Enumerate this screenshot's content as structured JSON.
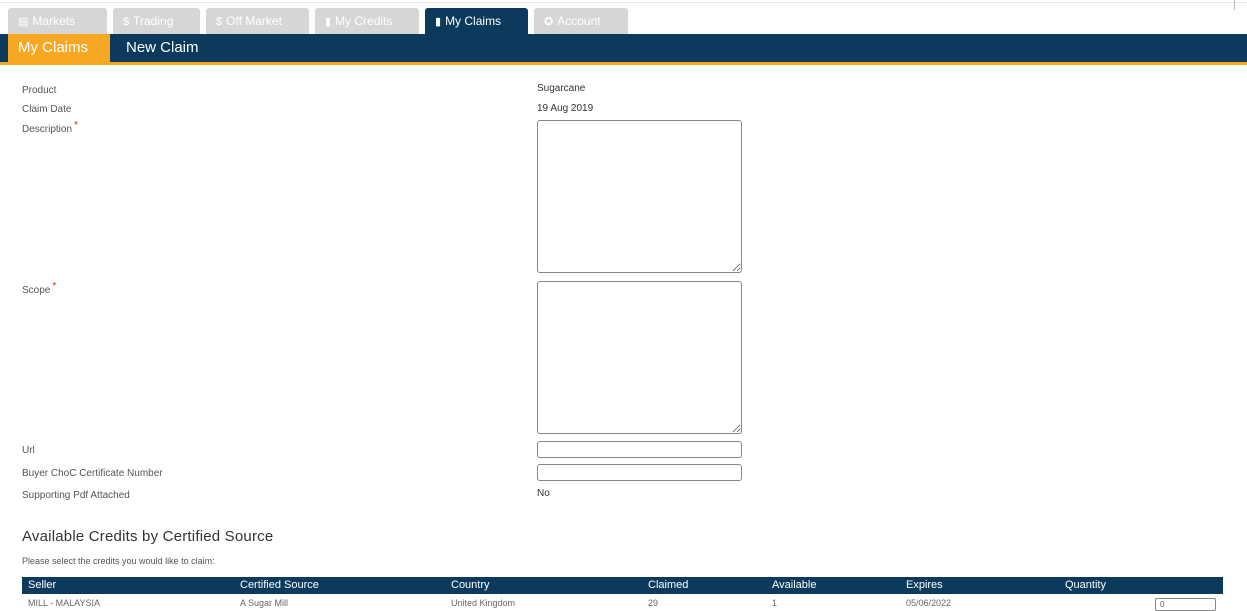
{
  "tabs": [
    {
      "icon": "list-icon",
      "glyph": "▤",
      "label": "Markets"
    },
    {
      "icon": "dollar-icon",
      "glyph": "$",
      "label": "Trading"
    },
    {
      "icon": "dollar-icon",
      "glyph": "$",
      "label": "Off Market"
    },
    {
      "icon": "document-icon",
      "glyph": "▮",
      "label": "My Credits"
    },
    {
      "icon": "document-icon",
      "glyph": "▮",
      "label": "My Claims"
    },
    {
      "icon": "gear-icon",
      "glyph": "✪",
      "label": "Account"
    }
  ],
  "active_tab": "My Claims",
  "subnav": {
    "active": "My Claims",
    "item": "New Claim"
  },
  "form": {
    "product_label": "Product",
    "product_value": "Sugarcane",
    "claim_date_label": "Claim Date",
    "claim_date_value": "19 Aug 2019",
    "description_label": "Description",
    "scope_label": "Scope",
    "required_mark": "*",
    "url_label": "Url",
    "choc_label": "Buyer ChoC Certificate Number",
    "pdf_label": "Supporting Pdf Attached",
    "pdf_value": "No"
  },
  "credits": {
    "title": "Available Credits by Certified Source",
    "hint": "Please select the credits you would like to claim:",
    "columns": [
      "Seller",
      "Certified Source",
      "Country",
      "Claimed",
      "Available",
      "Expires",
      "Quantity"
    ],
    "rows": [
      {
        "seller": "MILL - MALAYSIA",
        "source": "A Sugar Mill",
        "country": "United Kingdom",
        "claimed": "29",
        "available": "1",
        "expires": "05/06/2022",
        "quantity": "0"
      }
    ]
  },
  "colors": {
    "navy": "#0b3a5c",
    "orange": "#f7a823",
    "tab_inactive": "#d6d6d6",
    "required": "#e02020"
  }
}
